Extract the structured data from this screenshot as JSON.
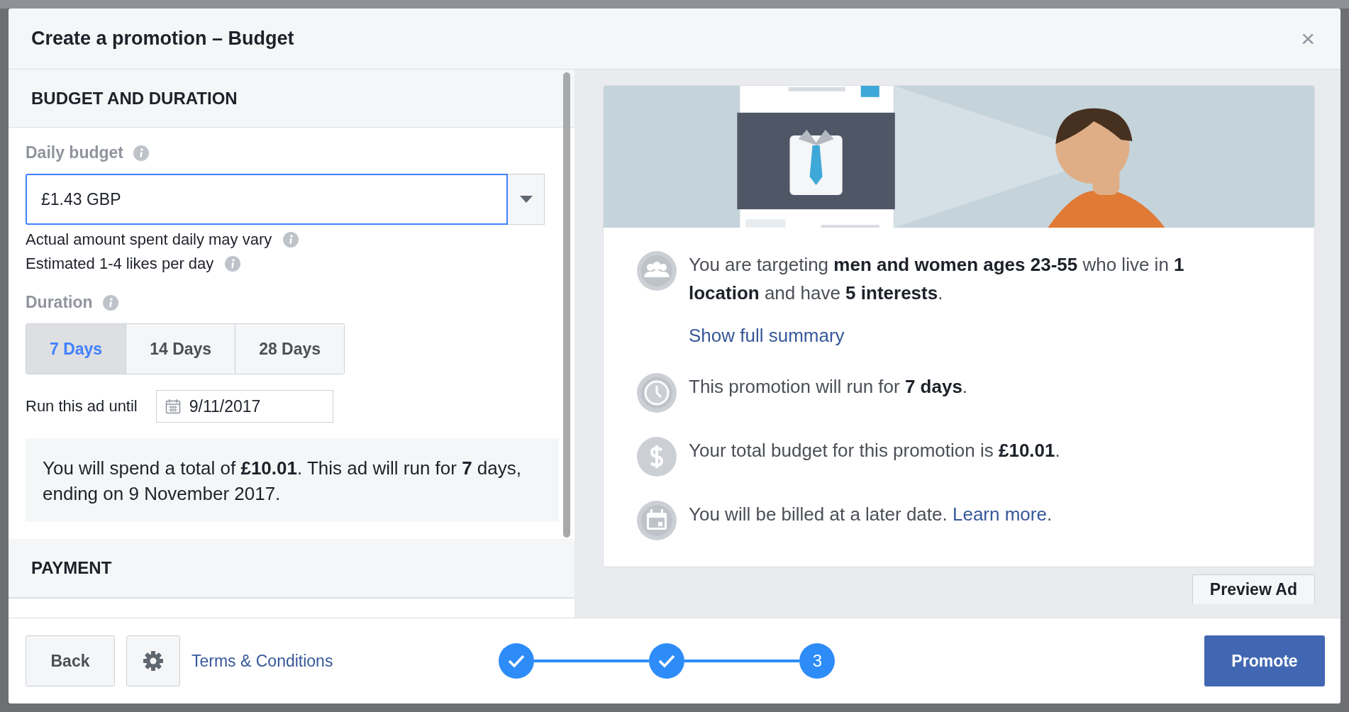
{
  "dialog": {
    "title": "Create a promotion – Budget",
    "close": "×"
  },
  "budget_section": {
    "heading": "BUDGET AND DURATION",
    "daily_budget_label": "Daily budget",
    "daily_budget_value": "£1.43 GBP",
    "notes": [
      "Actual amount spent daily may vary",
      "Estimated 1-4 likes per day"
    ],
    "duration_label": "Duration",
    "durations": [
      {
        "label": "7 Days",
        "selected": true
      },
      {
        "label": "14 Days",
        "selected": false
      },
      {
        "label": "28 Days",
        "selected": false
      }
    ],
    "run_until_label": "Run this ad until",
    "run_until_value": "9/11/2017",
    "summary": "You will spend a total of **£10.01**. This ad will run for **7** days, ending on 9 November 2017."
  },
  "payment_section": {
    "heading": "PAYMENT"
  },
  "audience_card": {
    "rows": [
      {
        "kind": "people",
        "text": "You are targeting **men and women ages 23-55** who live in **1 location** and have **5 interests**.",
        "link": "Show full summary"
      },
      {
        "kind": "clock",
        "text": "This promotion will run for **7 days**."
      },
      {
        "kind": "dollar",
        "text": "Your total budget for this promotion is **£10.01**."
      },
      {
        "kind": "calendar",
        "text": "You will be billed at a later date.",
        "inline_link": "Learn more",
        "suffix": "."
      }
    ]
  },
  "preview_button": "Preview Ad",
  "footer": {
    "back": "Back",
    "terms": "Terms & Conditions",
    "steps": [
      {
        "completed": true
      },
      {
        "completed": true
      },
      {
        "completed": false,
        "label": "3"
      }
    ],
    "promote": "Promote"
  }
}
